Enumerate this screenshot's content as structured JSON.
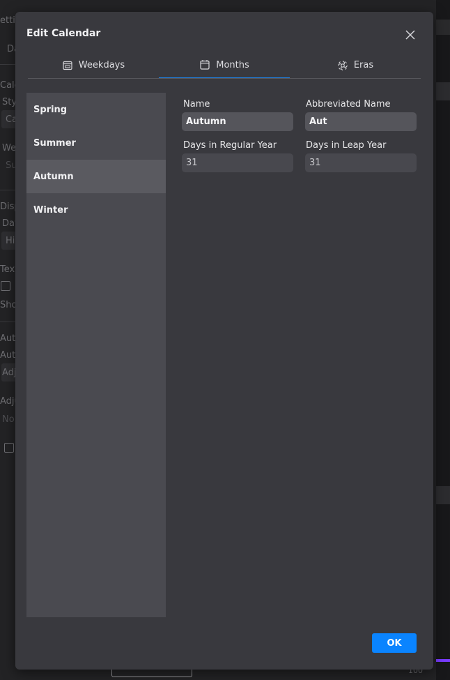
{
  "background": {
    "texts": [
      "etti",
      "Da",
      "Cale",
      "Sty",
      "Ca",
      "We",
      "Su",
      "Disp",
      "Day",
      "Hi",
      "Text",
      "Sho",
      "Auto",
      "Auto",
      "Adj",
      "Adju",
      "No",
      "100"
    ]
  },
  "dialog": {
    "title": "Edit Calendar",
    "close_icon": "close-icon",
    "tabs": [
      {
        "label": "Weekdays",
        "icon": "weekdays-icon",
        "active": false
      },
      {
        "label": "Months",
        "icon": "calendar-icon",
        "active": true
      },
      {
        "label": "Eras",
        "icon": "eras-icon",
        "active": false
      }
    ],
    "months": [
      {
        "label": "Spring",
        "selected": false
      },
      {
        "label": "Summer",
        "selected": false
      },
      {
        "label": "Autumn",
        "selected": true
      },
      {
        "label": "Winter",
        "selected": false
      }
    ],
    "form": {
      "name_label": "Name",
      "name_value": "Autumn",
      "abbr_label": "Abbreviated Name",
      "abbr_value": "Aut",
      "regular_label": "Days in Regular Year",
      "regular_value": "31",
      "leap_label": "Days in Leap Year",
      "leap_value": "31"
    },
    "ok_label": "OK"
  },
  "colors": {
    "accent": "#0a84ff",
    "dialog_bg": "#39393e",
    "list_bg": "#4a4a50",
    "selected_bg": "#5a5a60"
  }
}
